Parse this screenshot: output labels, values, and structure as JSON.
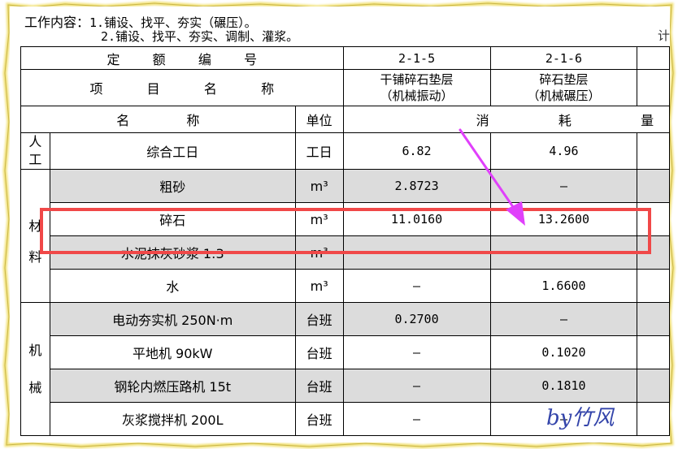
{
  "header": {
    "work_label": "工作内容：",
    "item1": "1.铺设、找平、夯实（碾压）。",
    "item2": "2.铺设、找平、夯实、调制、灌浆。",
    "edge_glyph": "计"
  },
  "table": {
    "quota_label": [
      "定",
      "额",
      "编",
      "号"
    ],
    "quota_codes": [
      "2-1-5",
      "2-1-6"
    ],
    "project_label": [
      "项",
      "目",
      "名",
      "称"
    ],
    "projects": [
      {
        "line1": "干铺碎石垫层",
        "line2": "（机械振动）"
      },
      {
        "line1": "碎石垫层",
        "line2": "（机械碾压）"
      }
    ],
    "col_name": [
      "名",
      "称"
    ],
    "col_unit": "单位",
    "consumption": [
      "消",
      "耗",
      "量"
    ],
    "groups": {
      "labor": [
        "人",
        "工"
      ],
      "material": [
        "材",
        "料"
      ],
      "machine": [
        "机",
        "械"
      ]
    },
    "rows": [
      {
        "name": "综合工日",
        "unit": "工日",
        "v1": "6.82",
        "v2": "4.96"
      },
      {
        "name": "粗砂",
        "unit": "m³",
        "v1": "2.8723",
        "v2": "—"
      },
      {
        "name": "碎石",
        "unit": "m³",
        "v1": "11.0160",
        "v2": "13.2600"
      },
      {
        "name": "水泥抹灰砂浆 1:3",
        "unit": "m³",
        "v1": "—",
        "v2": "—"
      },
      {
        "name": "水",
        "unit": "m³",
        "v1": "—",
        "v2": "1.6600"
      },
      {
        "name": "电动夯实机 250N·m",
        "unit": "台班",
        "v1": "0.2700",
        "v2": "—"
      },
      {
        "name": "平地机 90kW",
        "unit": "台班",
        "v1": "—",
        "v2": "0.1020"
      },
      {
        "name": "钢轮内燃压路机 15t",
        "unit": "台班",
        "v1": "—",
        "v2": "0.1810"
      },
      {
        "name": "灰浆搅拌机 200L",
        "unit": "台班",
        "v1": "—",
        "v2": "—"
      }
    ]
  },
  "annotation": {
    "highlight_color": "#f04848",
    "arrow_color": "#e040fb"
  },
  "watermark": "by竹风"
}
